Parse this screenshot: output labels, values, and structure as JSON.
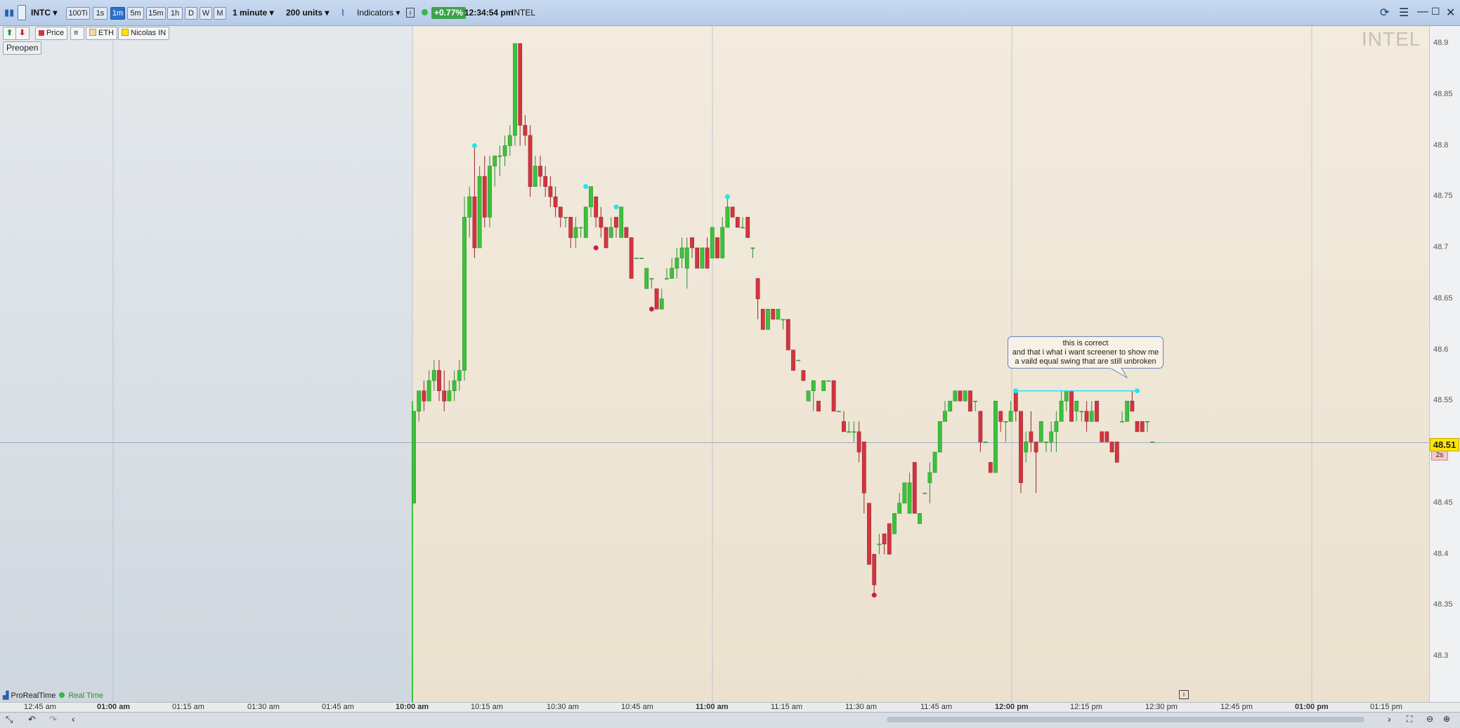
{
  "toolbar": {
    "symbol": "INTC",
    "timeframes": [
      "100Ti",
      "1s",
      "1m",
      "5m",
      "15m",
      "1h",
      "D",
      "W",
      "M"
    ],
    "active_timeframe": "1m",
    "interval": "1 minute",
    "units": "200 units",
    "indicators_label": "Indicators",
    "change": "+0.77%",
    "time": "12:34:54 pm",
    "name": "INTEL"
  },
  "legend": {
    "price": "Price",
    "eth": "ETH",
    "nicolas": "Nicolas IN"
  },
  "preopen_label": "Preopen",
  "watermark": "INTEL",
  "status": {
    "platform": "ProRealTime",
    "mode": "Real Time"
  },
  "price_tag": "48.51",
  "countdown": "2s",
  "callout": {
    "line1": "this is correct",
    "line2": "and that i what i want screener to show me",
    "line3": "a vaild equal swing that are still unbroken"
  },
  "colors": {
    "up": "#3cc23c",
    "down": "#d2353f",
    "swing_high": "#22e5ee",
    "swing_low": "#d31f3a"
  },
  "chart_data": {
    "type": "candlestick",
    "symbol": "INTC",
    "y_ticks": [
      "48.9",
      "48.85",
      "48.8",
      "48.75",
      "48.7",
      "48.65",
      "48.6",
      "48.55",
      "48.5",
      "48.45",
      "48.4",
      "48.35",
      "48.3"
    ],
    "x_ticks": [
      "12:45 am",
      "01:00 am",
      "01:15 am",
      "01:30 am",
      "01:45 am",
      "10:00 am",
      "10:15 am",
      "10:30 am",
      "10:45 am",
      "11:00 am",
      "11:15 am",
      "11:30 am",
      "11:45 am",
      "12:00 pm",
      "12:15 pm",
      "12:30 pm",
      "12:45 pm",
      "01:00 pm",
      "01:15 pm"
    ],
    "ylim": [
      48.27,
      48.91
    ],
    "last_price": 48.51,
    "candles": [
      {
        "t": 0,
        "o": 48.45,
        "h": 48.54,
        "l": 48.45,
        "c": 48.54
      },
      {
        "t": 1,
        "o": 48.54,
        "h": 48.56,
        "l": 48.53,
        "c": 48.56
      },
      {
        "t": 2,
        "o": 48.56,
        "h": 48.57,
        "l": 48.54,
        "c": 48.55
      },
      {
        "t": 3,
        "o": 48.55,
        "h": 48.58,
        "l": 48.55,
        "c": 48.57
      },
      {
        "t": 4,
        "o": 48.57,
        "h": 48.59,
        "l": 48.56,
        "c": 48.58
      },
      {
        "t": 5,
        "o": 48.58,
        "h": 48.59,
        "l": 48.55,
        "c": 48.56
      },
      {
        "t": 6,
        "o": 48.56,
        "h": 48.58,
        "l": 48.54,
        "c": 48.55
      },
      {
        "t": 7,
        "o": 48.55,
        "h": 48.57,
        "l": 48.55,
        "c": 48.56
      },
      {
        "t": 8,
        "o": 48.56,
        "h": 48.58,
        "l": 48.55,
        "c": 48.57
      },
      {
        "t": 9,
        "o": 48.57,
        "h": 48.59,
        "l": 48.56,
        "c": 48.58
      },
      {
        "t": 10,
        "o": 48.58,
        "h": 48.75,
        "l": 48.57,
        "c": 48.73
      },
      {
        "t": 11,
        "o": 48.73,
        "h": 48.76,
        "l": 48.71,
        "c": 48.75
      },
      {
        "t": 12,
        "o": 48.75,
        "h": 48.8,
        "l": 48.69,
        "c": 48.7
      },
      {
        "t": 13,
        "o": 48.7,
        "h": 48.78,
        "l": 48.7,
        "c": 48.77
      },
      {
        "t": 14,
        "o": 48.77,
        "h": 48.79,
        "l": 48.72,
        "c": 48.73
      },
      {
        "t": 15,
        "o": 48.73,
        "h": 48.79,
        "l": 48.72,
        "c": 48.78
      },
      {
        "t": 16,
        "o": 48.78,
        "h": 48.79,
        "l": 48.76,
        "c": 48.79
      },
      {
        "t": 17,
        "o": 48.79,
        "h": 48.8,
        "l": 48.77,
        "c": 48.79
      },
      {
        "t": 18,
        "o": 48.79,
        "h": 48.81,
        "l": 48.78,
        "c": 48.8
      },
      {
        "t": 19,
        "o": 48.8,
        "h": 48.82,
        "l": 48.79,
        "c": 48.81
      },
      {
        "t": 20,
        "o": 48.81,
        "h": 48.9,
        "l": 48.8,
        "c": 48.9
      },
      {
        "t": 21,
        "o": 48.9,
        "h": 48.9,
        "l": 48.8,
        "c": 48.82
      },
      {
        "t": 22,
        "o": 48.82,
        "h": 48.83,
        "l": 48.8,
        "c": 48.81
      },
      {
        "t": 23,
        "o": 48.81,
        "h": 48.82,
        "l": 48.75,
        "c": 48.76
      },
      {
        "t": 24,
        "o": 48.76,
        "h": 48.79,
        "l": 48.76,
        "c": 48.78
      },
      {
        "t": 25,
        "o": 48.78,
        "h": 48.79,
        "l": 48.76,
        "c": 48.77
      },
      {
        "t": 26,
        "o": 48.77,
        "h": 48.78,
        "l": 48.75,
        "c": 48.76
      },
      {
        "t": 27,
        "o": 48.76,
        "h": 48.77,
        "l": 48.74,
        "c": 48.75
      },
      {
        "t": 28,
        "o": 48.75,
        "h": 48.76,
        "l": 48.73,
        "c": 48.74
      },
      {
        "t": 29,
        "o": 48.74,
        "h": 48.74,
        "l": 48.72,
        "c": 48.73
      },
      {
        "t": 30,
        "o": 48.73,
        "h": 48.73,
        "l": 48.72,
        "c": 48.73
      },
      {
        "t": 31,
        "o": 48.73,
        "h": 48.73,
        "l": 48.7,
        "c": 48.71
      },
      {
        "t": 32,
        "o": 48.71,
        "h": 48.73,
        "l": 48.7,
        "c": 48.72
      },
      {
        "t": 33,
        "o": 48.72,
        "h": 48.72,
        "l": 48.71,
        "c": 48.72
      },
      {
        "t": 34,
        "o": 48.71,
        "h": 48.74,
        "l": 48.71,
        "c": 48.74
      },
      {
        "t": 35,
        "o": 48.74,
        "h": 48.76,
        "l": 48.73,
        "c": 48.76
      },
      {
        "t": 36,
        "o": 48.75,
        "h": 48.75,
        "l": 48.72,
        "c": 48.73
      },
      {
        "t": 37,
        "o": 48.73,
        "h": 48.74,
        "l": 48.71,
        "c": 48.72
      },
      {
        "t": 38,
        "o": 48.72,
        "h": 48.72,
        "l": 48.7,
        "c": 48.7
      },
      {
        "t": 39,
        "o": 48.71,
        "h": 48.73,
        "l": 48.71,
        "c": 48.72
      },
      {
        "t": 40,
        "o": 48.73,
        "h": 48.73,
        "l": 48.71,
        "c": 48.72
      },
      {
        "t": 41,
        "o": 48.71,
        "h": 48.74,
        "l": 48.71,
        "c": 48.74
      },
      {
        "t": 42,
        "o": 48.72,
        "h": 48.72,
        "l": 48.71,
        "c": 48.71
      },
      {
        "t": 43,
        "o": 48.71,
        "h": 48.71,
        "l": 48.67,
        "c": 48.67
      },
      {
        "t": 44,
        "o": 48.69,
        "h": 48.69,
        "l": 48.69,
        "c": 48.69
      },
      {
        "t": 45,
        "o": 48.69,
        "h": 48.69,
        "l": 48.69,
        "c": 48.69
      },
      {
        "t": 46,
        "o": 48.66,
        "h": 48.68,
        "l": 48.66,
        "c": 48.68
      },
      {
        "t": 47,
        "o": 48.67,
        "h": 48.67,
        "l": 48.66,
        "c": 48.67
      },
      {
        "t": 48,
        "o": 48.66,
        "h": 48.66,
        "l": 48.64,
        "c": 48.64
      },
      {
        "t": 49,
        "o": 48.64,
        "h": 48.66,
        "l": 48.64,
        "c": 48.65
      },
      {
        "t": 50,
        "o": 48.67,
        "h": 48.68,
        "l": 48.67,
        "c": 48.67
      },
      {
        "t": 51,
        "o": 48.67,
        "h": 48.69,
        "l": 48.67,
        "c": 48.68
      },
      {
        "t": 52,
        "o": 48.68,
        "h": 48.7,
        "l": 48.67,
        "c": 48.69
      },
      {
        "t": 53,
        "o": 48.69,
        "h": 48.71,
        "l": 48.68,
        "c": 48.7
      },
      {
        "t": 54,
        "o": 48.68,
        "h": 48.71,
        "l": 48.66,
        "c": 48.7
      },
      {
        "t": 55,
        "o": 48.71,
        "h": 48.71,
        "l": 48.69,
        "c": 48.7
      },
      {
        "t": 56,
        "o": 48.7,
        "h": 48.7,
        "l": 48.68,
        "c": 48.68
      },
      {
        "t": 57,
        "o": 48.68,
        "h": 48.7,
        "l": 48.68,
        "c": 48.7
      },
      {
        "t": 58,
        "o": 48.7,
        "h": 48.71,
        "l": 48.68,
        "c": 48.68
      },
      {
        "t": 59,
        "o": 48.69,
        "h": 48.72,
        "l": 48.69,
        "c": 48.72
      },
      {
        "t": 60,
        "o": 48.71,
        "h": 48.71,
        "l": 48.69,
        "c": 48.69
      },
      {
        "t": 61,
        "o": 48.69,
        "h": 48.73,
        "l": 48.69,
        "c": 48.72
      },
      {
        "t": 62,
        "o": 48.72,
        "h": 48.75,
        "l": 48.72,
        "c": 48.74
      },
      {
        "t": 63,
        "o": 48.74,
        "h": 48.74,
        "l": 48.73,
        "c": 48.73
      },
      {
        "t": 64,
        "o": 48.73,
        "h": 48.73,
        "l": 48.72,
        "c": 48.72
      },
      {
        "t": 65,
        "o": 48.72,
        "h": 48.73,
        "l": 48.72,
        "c": 48.72
      },
      {
        "t": 66,
        "o": 48.73,
        "h": 48.73,
        "l": 48.71,
        "c": 48.71
      },
      {
        "t": 67,
        "o": 48.7,
        "h": 48.7,
        "l": 48.69,
        "c": 48.7
      },
      {
        "t": 68,
        "o": 48.67,
        "h": 48.67,
        "l": 48.63,
        "c": 48.65
      },
      {
        "t": 69,
        "o": 48.64,
        "h": 48.64,
        "l": 48.62,
        "c": 48.62
      },
      {
        "t": 70,
        "o": 48.62,
        "h": 48.64,
        "l": 48.62,
        "c": 48.64
      },
      {
        "t": 71,
        "o": 48.64,
        "h": 48.64,
        "l": 48.63,
        "c": 48.63
      },
      {
        "t": 72,
        "o": 48.63,
        "h": 48.64,
        "l": 48.63,
        "c": 48.64
      },
      {
        "t": 73,
        "o": 48.63,
        "h": 48.63,
        "l": 48.62,
        "c": 48.63
      },
      {
        "t": 74,
        "o": 48.63,
        "h": 48.63,
        "l": 48.6,
        "c": 48.6
      },
      {
        "t": 75,
        "o": 48.6,
        "h": 48.6,
        "l": 48.58,
        "c": 48.58
      },
      {
        "t": 76,
        "o": 48.59,
        "h": 48.59,
        "l": 48.59,
        "c": 48.59
      },
      {
        "t": 77,
        "o": 48.58,
        "h": 48.58,
        "l": 48.57,
        "c": 48.57
      },
      {
        "t": 78,
        "o": 48.55,
        "h": 48.56,
        "l": 48.55,
        "c": 48.56
      },
      {
        "t": 79,
        "o": 48.56,
        "h": 48.57,
        "l": 48.54,
        "c": 48.57
      },
      {
        "t": 80,
        "o": 48.55,
        "h": 48.55,
        "l": 48.54,
        "c": 48.54
      },
      {
        "t": 81,
        "o": 48.56,
        "h": 48.57,
        "l": 48.56,
        "c": 48.57
      },
      {
        "t": 82,
        "o": 48.57,
        "h": 48.57,
        "l": 48.57,
        "c": 48.57
      },
      {
        "t": 83,
        "o": 48.57,
        "h": 48.57,
        "l": 48.54,
        "c": 48.54
      },
      {
        "t": 84,
        "o": 48.54,
        "h": 48.54,
        "l": 48.54,
        "c": 48.54
      },
      {
        "t": 85,
        "o": 48.53,
        "h": 48.54,
        "l": 48.52,
        "c": 48.52
      },
      {
        "t": 86,
        "o": 48.52,
        "h": 48.53,
        "l": 48.52,
        "c": 48.52
      },
      {
        "t": 87,
        "o": 48.52,
        "h": 48.53,
        "l": 48.51,
        "c": 48.52
      },
      {
        "t": 88,
        "o": 48.52,
        "h": 48.53,
        "l": 48.49,
        "c": 48.5
      },
      {
        "t": 89,
        "o": 48.51,
        "h": 48.51,
        "l": 48.44,
        "c": 48.46
      },
      {
        "t": 90,
        "o": 48.45,
        "h": 48.45,
        "l": 48.39,
        "c": 48.39
      },
      {
        "t": 91,
        "o": 48.4,
        "h": 48.4,
        "l": 48.36,
        "c": 48.37
      },
      {
        "t": 92,
        "o": 48.41,
        "h": 48.42,
        "l": 48.4,
        "c": 48.41
      },
      {
        "t": 93,
        "o": 48.42,
        "h": 48.42,
        "l": 48.4,
        "c": 48.41
      },
      {
        "t": 94,
        "o": 48.43,
        "h": 48.43,
        "l": 48.4,
        "c": 48.4
      },
      {
        "t": 95,
        "o": 48.42,
        "h": 48.44,
        "l": 48.42,
        "c": 48.44
      },
      {
        "t": 96,
        "o": 48.44,
        "h": 48.46,
        "l": 48.44,
        "c": 48.45
      },
      {
        "t": 97,
        "o": 48.45,
        "h": 48.47,
        "l": 48.45,
        "c": 48.47
      },
      {
        "t": 98,
        "o": 48.44,
        "h": 48.48,
        "l": 48.44,
        "c": 48.47
      },
      {
        "t": 99,
        "o": 48.49,
        "h": 48.49,
        "l": 48.44,
        "c": 48.44
      },
      {
        "t": 100,
        "o": 48.43,
        "h": 48.44,
        "l": 48.43,
        "c": 48.44
      },
      {
        "t": 101,
        "o": 48.46,
        "h": 48.46,
        "l": 48.46,
        "c": 48.46
      },
      {
        "t": 102,
        "o": 48.47,
        "h": 48.49,
        "l": 48.45,
        "c": 48.48
      },
      {
        "t": 103,
        "o": 48.48,
        "h": 48.5,
        "l": 48.48,
        "c": 48.5
      },
      {
        "t": 104,
        "o": 48.5,
        "h": 48.53,
        "l": 48.5,
        "c": 48.53
      },
      {
        "t": 105,
        "o": 48.53,
        "h": 48.55,
        "l": 48.53,
        "c": 48.54
      },
      {
        "t": 106,
        "o": 48.54,
        "h": 48.55,
        "l": 48.54,
        "c": 48.55
      },
      {
        "t": 107,
        "o": 48.55,
        "h": 48.56,
        "l": 48.55,
        "c": 48.56
      },
      {
        "t": 108,
        "o": 48.56,
        "h": 48.56,
        "l": 48.55,
        "c": 48.55
      },
      {
        "t": 109,
        "o": 48.55,
        "h": 48.56,
        "l": 48.55,
        "c": 48.56
      },
      {
        "t": 110,
        "o": 48.56,
        "h": 48.56,
        "l": 48.54,
        "c": 48.54
      },
      {
        "t": 111,
        "o": 48.55,
        "h": 48.55,
        "l": 48.54,
        "c": 48.55
      },
      {
        "t": 112,
        "o": 48.54,
        "h": 48.54,
        "l": 48.5,
        "c": 48.51
      },
      {
        "t": 113,
        "o": 48.51,
        "h": 48.51,
        "l": 48.51,
        "c": 48.51
      },
      {
        "t": 114,
        "o": 48.49,
        "h": 48.49,
        "l": 48.48,
        "c": 48.48
      },
      {
        "t": 115,
        "o": 48.48,
        "h": 48.55,
        "l": 48.48,
        "c": 48.55
      },
      {
        "t": 116,
        "o": 48.54,
        "h": 48.54,
        "l": 48.52,
        "c": 48.53
      },
      {
        "t": 117,
        "o": 48.53,
        "h": 48.53,
        "l": 48.51,
        "c": 48.53
      },
      {
        "t": 118,
        "o": 48.53,
        "h": 48.55,
        "l": 48.53,
        "c": 48.54
      },
      {
        "t": 119,
        "o": 48.56,
        "h": 48.56,
        "l": 48.53,
        "c": 48.54
      },
      {
        "t": 120,
        "o": 48.54,
        "h": 48.54,
        "l": 48.46,
        "c": 48.47
      },
      {
        "t": 121,
        "o": 48.5,
        "h": 48.52,
        "l": 48.49,
        "c": 48.51
      },
      {
        "t": 122,
        "o": 48.52,
        "h": 48.54,
        "l": 48.5,
        "c": 48.51
      },
      {
        "t": 123,
        "o": 48.51,
        "h": 48.51,
        "l": 48.46,
        "c": 48.5
      },
      {
        "t": 124,
        "o": 48.51,
        "h": 48.53,
        "l": 48.51,
        "c": 48.53
      },
      {
        "t": 125,
        "o": 48.51,
        "h": 48.51,
        "l": 48.5,
        "c": 48.51
      },
      {
        "t": 126,
        "o": 48.51,
        "h": 48.53,
        "l": 48.5,
        "c": 48.52
      },
      {
        "t": 127,
        "o": 48.52,
        "h": 48.54,
        "l": 48.5,
        "c": 48.53
      },
      {
        "t": 128,
        "o": 48.53,
        "h": 48.56,
        "l": 48.53,
        "c": 48.55
      },
      {
        "t": 129,
        "o": 48.55,
        "h": 48.56,
        "l": 48.54,
        "c": 48.56
      },
      {
        "t": 130,
        "o": 48.56,
        "h": 48.56,
        "l": 48.53,
        "c": 48.53
      },
      {
        "t": 131,
        "o": 48.54,
        "h": 48.55,
        "l": 48.53,
        "c": 48.55
      },
      {
        "t": 132,
        "o": 48.54,
        "h": 48.54,
        "l": 48.53,
        "c": 48.54
      },
      {
        "t": 133,
        "o": 48.54,
        "h": 48.55,
        "l": 48.52,
        "c": 48.53
      },
      {
        "t": 134,
        "o": 48.53,
        "h": 48.55,
        "l": 48.53,
        "c": 48.54
      },
      {
        "t": 135,
        "o": 48.55,
        "h": 48.55,
        "l": 48.53,
        "c": 48.53
      },
      {
        "t": 136,
        "o": 48.52,
        "h": 48.52,
        "l": 48.51,
        "c": 48.51
      },
      {
        "t": 137,
        "o": 48.52,
        "h": 48.52,
        "l": 48.51,
        "c": 48.51
      },
      {
        "t": 138,
        "o": 48.51,
        "h": 48.51,
        "l": 48.5,
        "c": 48.5
      },
      {
        "t": 139,
        "o": 48.51,
        "h": 48.51,
        "l": 48.49,
        "c": 48.49
      },
      {
        "t": 140,
        "o": 48.53,
        "h": 48.54,
        "l": 48.53,
        "c": 48.53
      },
      {
        "t": 141,
        "o": 48.53,
        "h": 48.55,
        "l": 48.53,
        "c": 48.55
      },
      {
        "t": 142,
        "o": 48.55,
        "h": 48.56,
        "l": 48.54,
        "c": 48.54
      },
      {
        "t": 143,
        "o": 48.53,
        "h": 48.53,
        "l": 48.52,
        "c": 48.52
      },
      {
        "t": 144,
        "o": 48.53,
        "h": 48.53,
        "l": 48.52,
        "c": 48.52
      },
      {
        "t": 145,
        "o": 48.53,
        "h": 48.53,
        "l": 48.52,
        "c": 48.53
      },
      {
        "t": 146,
        "o": 48.51,
        "h": 48.51,
        "l": 48.51,
        "c": 48.51
      }
    ],
    "swing_highs": [
      {
        "t": 12,
        "y": 48.8
      },
      {
        "t": 34,
        "y": 48.76
      },
      {
        "t": 40,
        "y": 48.74
      },
      {
        "t": 62,
        "y": 48.75
      },
      {
        "t": 119,
        "y": 48.56
      },
      {
        "t": 143,
        "y": 48.56
      }
    ],
    "swing_lows": [
      {
        "t": 36,
        "y": 48.7
      },
      {
        "t": 47,
        "y": 48.64
      },
      {
        "t": 91,
        "y": 48.36
      }
    ],
    "equal_swing_line": {
      "t1": 119,
      "t2": 143,
      "y": 48.56
    }
  }
}
